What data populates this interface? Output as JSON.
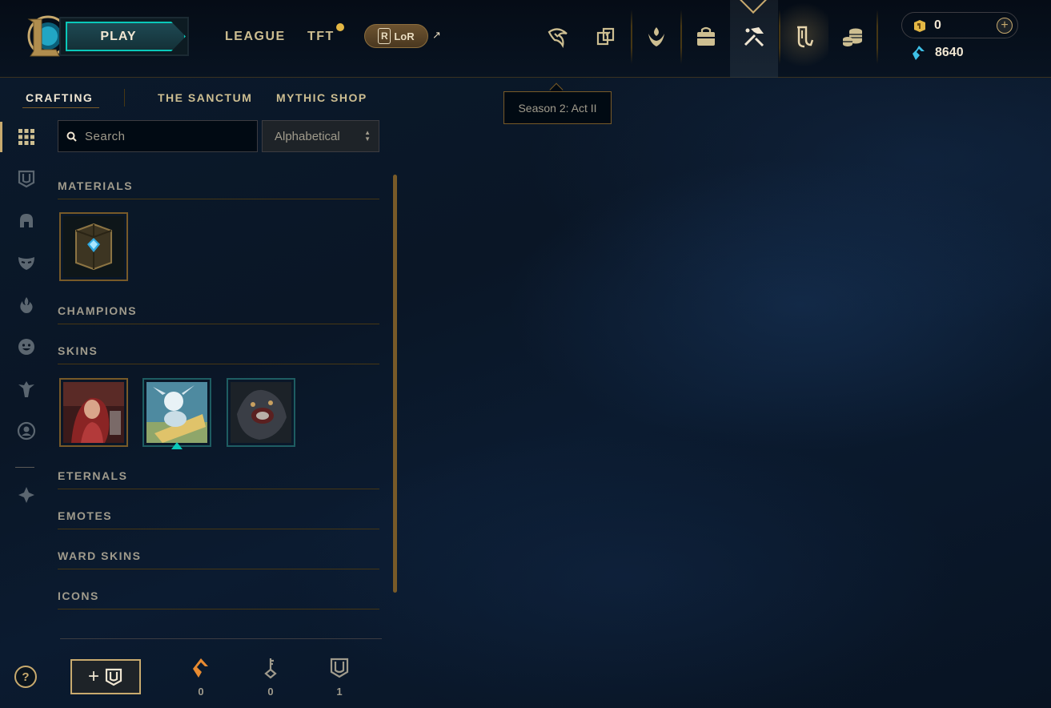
{
  "header": {
    "play_label": "PLAY",
    "nav": {
      "league": "LEAGUE",
      "tft": "TFT",
      "lor": "LoR"
    }
  },
  "currency": {
    "rp": "0",
    "blue_essence": "8640"
  },
  "tooltip": "Season 2: Act II",
  "subnav": {
    "crafting": "CRAFTING",
    "sanctum": "THE SANCTUM",
    "mythic_shop": "MYTHIC SHOP"
  },
  "search": {
    "placeholder": "Search"
  },
  "sort": {
    "selected": "Alphabetical"
  },
  "categories": {
    "materials": "MATERIALS",
    "champions": "CHAMPIONS",
    "skins": "SKINS",
    "eternals": "ETERNALS",
    "emotes": "EMOTES",
    "ward_skins": "WARD SKINS",
    "icons": "ICONS"
  },
  "footer": {
    "orange_essence": "0",
    "keys": "0",
    "chests": "1"
  },
  "help": "?",
  "colors": {
    "gold": "#c8aa6e",
    "teal": "#0ac8b9",
    "background": "#0a1626"
  }
}
